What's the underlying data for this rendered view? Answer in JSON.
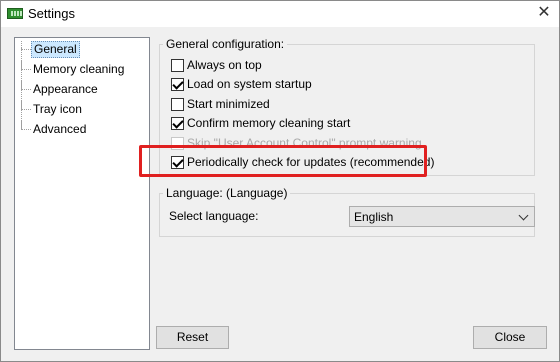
{
  "window": {
    "title": "Settings",
    "app_icon": "memory-chip-icon",
    "close_glyph": "✕"
  },
  "tree": {
    "items": [
      {
        "label": "General",
        "selected": true
      },
      {
        "label": "Memory cleaning"
      },
      {
        "label": "Appearance"
      },
      {
        "label": "Tray icon"
      },
      {
        "label": "Advanced"
      }
    ]
  },
  "general": {
    "group_title": "General configuration:",
    "options": [
      {
        "label": "Always on top",
        "checked": false,
        "enabled": true
      },
      {
        "label": "Load on system startup",
        "checked": true,
        "enabled": true
      },
      {
        "label": "Start minimized",
        "checked": false,
        "enabled": true
      },
      {
        "label": "Confirm memory cleaning start",
        "checked": true,
        "enabled": true
      },
      {
        "label": "Skip \"User Account Control\" prompt warning",
        "checked": false,
        "enabled": false
      },
      {
        "label": "Periodically check for updates (recommended)",
        "checked": true,
        "enabled": true
      }
    ]
  },
  "language": {
    "group_title": "Language: (Language)",
    "select_label": "Select language:",
    "selected_value": "English"
  },
  "buttons": {
    "reset": "Reset",
    "close": "Close"
  },
  "colors": {
    "highlight": "#e02020",
    "selection": "#cce8ff"
  }
}
